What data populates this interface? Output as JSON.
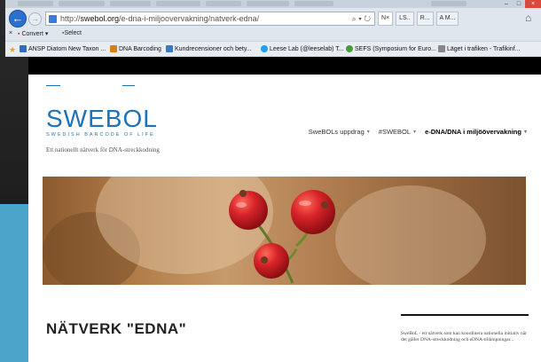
{
  "browser": {
    "url_prefix": "http://",
    "url_host": "swebol.org",
    "url_path": "/e-dna-i-miljoovervakning/natverk-edna/",
    "addr_tools": "⌕ ▾ ↻",
    "tabs": [
      {
        "label": "N×"
      },
      {
        "label": "LS.."
      },
      {
        "label": "R..."
      },
      {
        "label": "A M..."
      }
    ],
    "commands": {
      "close": "×",
      "convert": "Convert",
      "select": "Select"
    },
    "favorites": [
      {
        "label": "ANSP Diatom New Taxon ...",
        "color": "#2f6fb8"
      },
      {
        "label": "DNA Barcoding",
        "color": "#e07b1a"
      },
      {
        "label": "Kundrecensioner och bety...",
        "color": "#3a78c9"
      },
      {
        "label": "Leese Lab (@leeselab) T...",
        "color": "#1da1f2"
      },
      {
        "label": "SEFS (Symposium for Euro...",
        "color": "#4a9b3c"
      },
      {
        "label": "Läget i trafiken - Trafikinf...",
        "color": "#888888"
      }
    ]
  },
  "site": {
    "logo_word": "SWEBOL",
    "logo_sub": "SWEDISH BARCODE OF LIFE",
    "tagline": "Ett nationellt nätverk för DNA-streckkodning",
    "nav": [
      {
        "label": "SweBOLs uppdrag",
        "current": false
      },
      {
        "label": "#SWEBOL",
        "current": false
      },
      {
        "label": "e-DNA/DNA i miljöövervakning",
        "current": true
      }
    ],
    "page_title": "NÄTVERK \"EDNA\"",
    "sidebar_text": "SweBoL - ett nätverk som kan koordinera nationella initiativ när det gäller DNA-streckkodning och eDNA-tillämpningar..."
  },
  "colors": {
    "brand_blue": "#1e73b8",
    "berry_red": "#d8242a"
  }
}
